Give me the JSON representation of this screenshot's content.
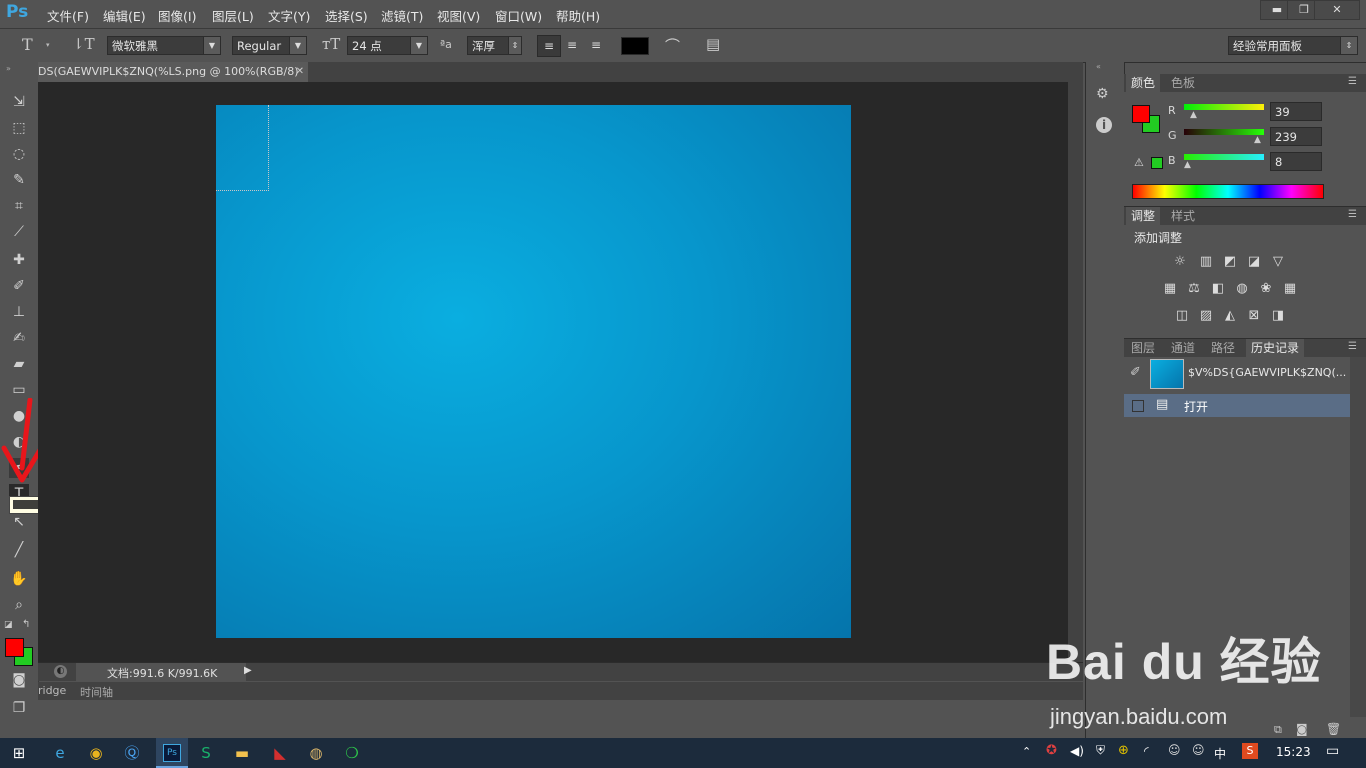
{
  "app": {
    "logo": "Ps"
  },
  "menu": [
    "文件(F)",
    "编辑(E)",
    "图像(I)",
    "图层(L)",
    "文字(Y)",
    "选择(S)",
    "滤镜(T)",
    "视图(V)",
    "窗口(W)",
    "帮助(H)"
  ],
  "window_controls": {
    "minimize": "▬",
    "restore": "❐",
    "close": "✕"
  },
  "options": {
    "font_family": "微软雅黑",
    "font_style": "Regular",
    "font_size": "24 点",
    "aa_label": "ªa",
    "anti_alias": "浑厚",
    "workspace": "经验常用面板",
    "text_color": "#000000"
  },
  "document": {
    "tab_title": "DS(GAEWVIPLK$ZNQ(%LS.png @ 100%(RGB/8)",
    "status": "文档:991.6 K/991.6K",
    "bottom_tabs": [
      "ridge",
      "时间轴"
    ]
  },
  "colors": {
    "foreground": "#ff0000",
    "background": "#22cc22",
    "accent": "#3fa7e0"
  },
  "color_panel": {
    "tabs": [
      "颜色",
      "色板"
    ],
    "r_label": "R",
    "g_label": "G",
    "b_label": "B",
    "r": "39",
    "g": "239",
    "b": "8"
  },
  "adjust_panel": {
    "tabs": [
      "调整",
      "样式"
    ],
    "title": "添加调整"
  },
  "history_panel": {
    "tabs": [
      "图层",
      "通道",
      "路径",
      "历史记录"
    ],
    "snapshot_name": "$V%DS{GAEWVIPLK$ZNQ(...",
    "steps": [
      "打开"
    ]
  },
  "taskbar": {
    "time": "15:23",
    "ime": "中"
  },
  "watermark": {
    "brand": "Bai du 经验",
    "url": "jingyan.baidu.com"
  }
}
